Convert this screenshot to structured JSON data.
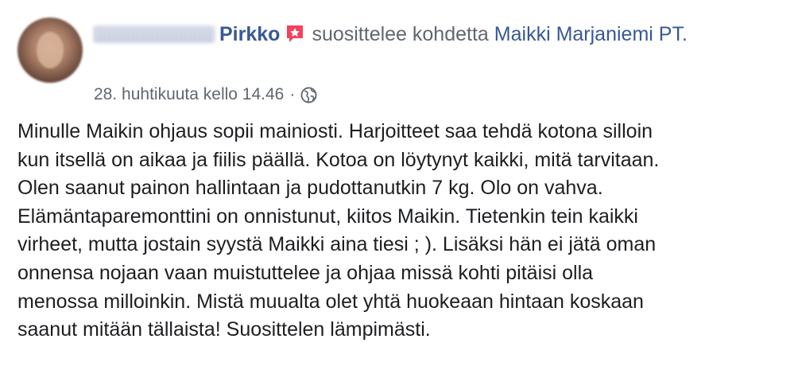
{
  "post": {
    "author_name": "Pirkko",
    "recommend_icon": "recommend-flag-icon",
    "verb": "suosittelee kohdetta",
    "page_name": "Maikki Marjaniemi PT.",
    "timestamp": "28. huhtikuuta kello 14.46",
    "separator": "·",
    "privacy_icon": "globe-icon",
    "text": "Minulle Maikin ohjaus sopii mainiosti. Harjoitteet saa tehdä kotona silloin\nkun itsellä on aikaa ja fiilis päällä. Kotoa on löytynyt kaikki, mitä tarvitaan.\nOlen saanut painon hallintaan ja pudottanutkin 7 kg. Olo on vahva.\nElämäntaparemonttini on onnistunut, kiitos Maikin. Tietenkin tein kaikki\nvirheet, mutta jostain syystä Maikki aina tiesi ; ). Lisäksi hän ei jätä oman\nonnensa nojaan vaan muistuttelee ja ohjaa missä kohti pitäisi olla\nmenossa milloinkin. Mistä muualta olet yhtä huokeaan hintaan koskaan\nsaanut mitään tällaista! Suosittelen lämpimästi."
  },
  "colors": {
    "link": "#385898",
    "secondary_text": "#606770",
    "body_text": "#1c1e21",
    "recommend_badge": "#f3425f"
  }
}
